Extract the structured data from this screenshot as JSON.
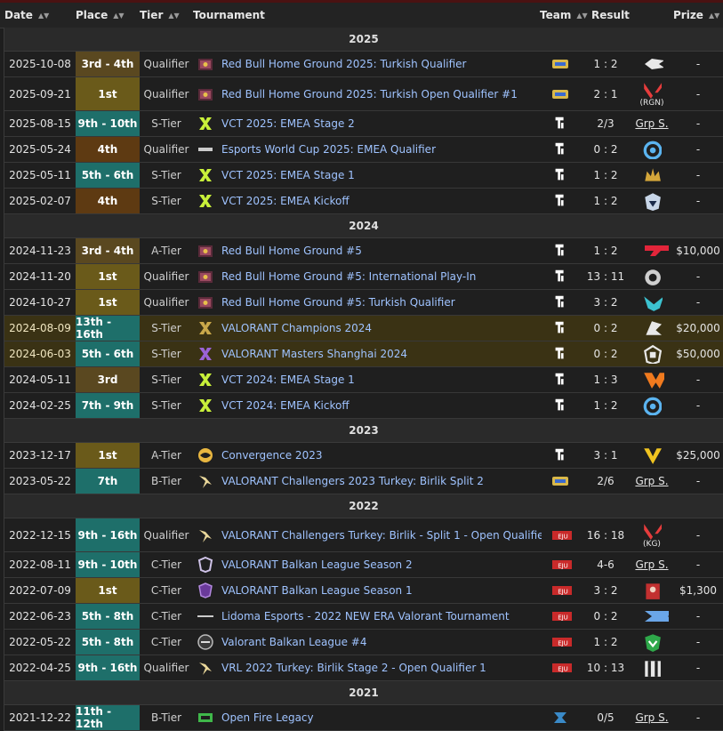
{
  "header": {
    "date": "Date",
    "place": "Place",
    "tier": "Tier",
    "tournament": "Tournament",
    "team": "Team",
    "result": "Result",
    "prize": "Prize"
  },
  "sections": [
    {
      "year": "2025",
      "rows": [
        {
          "date": "2025-10-08",
          "place": "3rd - 4th",
          "placeClass": "third",
          "tier": "Qualifier",
          "tierIcon": "redbull-icon",
          "tournament": "Red Bull Home Ground 2025: Turkish Qualifier",
          "team": "team-logo-yellow-icon",
          "score": "1 : 2",
          "opponent": "horse-head-icon",
          "prize": "-",
          "h": 29
        },
        {
          "date": "2025-09-21",
          "place": "1st",
          "placeClass": "gold",
          "tier": "Qualifier",
          "tierIcon": "redbull-icon",
          "tournament": "Red Bull Home Ground 2025: Turkish Open Qualifier #1",
          "team": "team-logo-yellow-icon",
          "score": "2 : 1",
          "opponent": "valorant-red-icon",
          "opponentLabel": "(RGN)",
          "prize": "-",
          "h": 38
        },
        {
          "date": "2025-08-15",
          "place": "9th - 10th",
          "placeClass": "teal",
          "tier": "S-Tier",
          "tierIcon": "vct-icon",
          "tournament": "VCT 2025: EMEA Stage 2",
          "team": "team-logo-white-icon",
          "score": "2/3",
          "opponent": "",
          "opponentText": "Grp S.",
          "prize": "-",
          "h": 29
        },
        {
          "date": "2025-05-24",
          "place": "4th",
          "placeClass": "fourth",
          "tier": "Qualifier",
          "tierIcon": "ewc-icon",
          "tournament": "Esports World Cup 2025: EMEA Qualifier",
          "team": "team-logo-white-icon",
          "score": "0 : 2",
          "opponent": "blue-swirl-icon",
          "prize": "-",
          "h": 29
        },
        {
          "date": "2025-05-11",
          "place": "5th - 6th",
          "placeClass": "teal",
          "tier": "S-Tier",
          "tierIcon": "vct-icon",
          "tournament": "VCT 2025: EMEA Stage 1",
          "team": "team-logo-white-icon",
          "score": "1 : 2",
          "opponent": "gold-crown-icon",
          "prize": "-",
          "h": 29
        },
        {
          "date": "2025-02-07",
          "place": "4th",
          "placeClass": "fourth",
          "tier": "S-Tier",
          "tierIcon": "vct-icon",
          "tournament": "VCT 2025: EMEA Kickoff",
          "team": "team-logo-white-icon",
          "score": "1 : 2",
          "opponent": "liquid-icon",
          "prize": "-",
          "h": 29
        }
      ]
    },
    {
      "year": "2024",
      "rows": [
        {
          "date": "2024-11-23",
          "place": "3rd - 4th",
          "placeClass": "third",
          "tier": "A-Tier",
          "tierIcon": "redbull-icon",
          "tournament": "Red Bull Home Ground #5",
          "team": "team-logo-white-icon",
          "score": "1 : 2",
          "opponent": "t1-icon",
          "prize": "$10,000",
          "h": 29
        },
        {
          "date": "2024-11-20",
          "place": "1st",
          "placeClass": "gold",
          "tier": "Qualifier",
          "tierIcon": "redbull-icon",
          "tournament": "Red Bull Home Ground #5: International Play-In",
          "team": "team-logo-white-icon",
          "score": "13 : 11",
          "opponent": "g2-icon",
          "prize": "-",
          "h": 29
        },
        {
          "date": "2024-10-27",
          "place": "1st",
          "placeClass": "gold",
          "tier": "Qualifier",
          "tierIcon": "redbull-icon",
          "tournament": "Red Bull Home Ground #5: Turkish Qualifier",
          "team": "team-logo-white-icon",
          "score": "3 : 2",
          "opponent": "teal-wings-icon",
          "prize": "-",
          "h": 29
        },
        {
          "date": "2024-08-09",
          "place": "13th - 16th",
          "placeClass": "teal",
          "tier": "S-Tier",
          "tierIcon": "champions-icon",
          "tournament": "VALORANT Champions 2024",
          "team": "team-logo-white-icon",
          "score": "0 : 2",
          "opponent": "prx-icon",
          "prize": "$20,000",
          "h": 29,
          "hl": true
        },
        {
          "date": "2024-06-03",
          "place": "5th - 6th",
          "placeClass": "teal",
          "tier": "S-Tier",
          "tierIcon": "masters-icon",
          "tournament": "VALORANT Masters Shanghai 2024",
          "team": "team-logo-white-icon",
          "score": "0 : 2",
          "opponent": "fnatic-white-icon",
          "prize": "$50,000",
          "h": 29,
          "hl": true
        },
        {
          "date": "2024-05-11",
          "place": "3rd",
          "placeClass": "third",
          "tier": "S-Tier",
          "tierIcon": "vct-icon",
          "tournament": "VCT 2024: EMEA Stage 1",
          "team": "team-logo-white-icon",
          "score": "1 : 3",
          "opponent": "fnatic-orange-icon",
          "prize": "-",
          "h": 29
        },
        {
          "date": "2024-02-25",
          "place": "7th - 9th",
          "placeClass": "teal",
          "tier": "S-Tier",
          "tierIcon": "vct-icon",
          "tournament": "VCT 2024: EMEA Kickoff",
          "team": "team-logo-white-icon",
          "score": "1 : 2",
          "opponent": "blue-swirl-icon",
          "prize": "-",
          "h": 29
        }
      ]
    },
    {
      "year": "2023",
      "rows": [
        {
          "date": "2023-12-17",
          "place": "1st",
          "placeClass": "gold",
          "tier": "A-Tier",
          "tierIcon": "convergence-icon",
          "tournament": "Convergence 2023",
          "team": "team-logo-white-icon",
          "score": "3 : 1",
          "opponent": "vitality-icon",
          "prize": "$25,000",
          "h": 29
        },
        {
          "date": "2023-05-22",
          "place": "7th",
          "placeClass": "teal",
          "tier": "B-Tier",
          "tierIcon": "challengers-icon",
          "tournament": "VALORANT Challengers 2023 Turkey: Birlik Split 2",
          "team": "team-logo-yellow-icon",
          "score": "2/6",
          "opponent": "",
          "opponentText": "Grp S.",
          "prize": "-",
          "h": 29
        }
      ]
    },
    {
      "year": "2022",
      "rows": [
        {
          "date": "2022-12-15",
          "place": "9th - 16th",
          "placeClass": "teal",
          "tier": "Qualifier",
          "tierIcon": "challengers-icon",
          "tournament": "VALORANT Challengers Turkey: Birlik - Split 1 - Open Qualifier 2",
          "team": "team-logo-red-icon",
          "score": "16 : 18",
          "opponent": "valorant-red-icon",
          "opponentLabel": "(KG)",
          "prize": "-",
          "h": 38
        },
        {
          "date": "2022-08-11",
          "place": "9th - 10th",
          "placeClass": "teal",
          "tier": "C-Tier",
          "tierIcon": "balkan-icon",
          "tournament": "VALORANT Balkan League Season 2",
          "team": "team-logo-red-icon",
          "score": "4-6",
          "opponent": "",
          "opponentText": "Grp S.",
          "prize": "-",
          "h": 29
        },
        {
          "date": "2022-07-09",
          "place": "1st",
          "placeClass": "gold",
          "tier": "C-Tier",
          "tierIcon": "balkan-purple-icon",
          "tournament": "VALORANT Balkan League Season 1",
          "team": "team-logo-red-icon",
          "score": "3 : 2",
          "opponent": "red-char-icon",
          "prize": "$1,300",
          "h": 29
        },
        {
          "date": "2022-06-23",
          "place": "5th - 8th",
          "placeClass": "teal",
          "tier": "C-Tier",
          "tierIcon": "lidoma-icon",
          "tournament": "Lidoma Esports - 2022 NEW ERA Valorant Tournament",
          "team": "team-logo-red-icon",
          "score": "0 : 2",
          "opponent": "fx-icon",
          "prize": "-",
          "h": 29
        },
        {
          "date": "2022-05-22",
          "place": "5th - 8th",
          "placeClass": "teal",
          "tier": "C-Tier",
          "tierIcon": "balkan-grey-icon",
          "tournament": "Valorant Balkan League #4",
          "team": "team-logo-red-icon",
          "score": "1 : 2",
          "opponent": "green-shield-icon",
          "prize": "-",
          "h": 29
        },
        {
          "date": "2022-04-25",
          "place": "9th - 16th",
          "placeClass": "teal",
          "tier": "Qualifier",
          "tierIcon": "challengers-icon",
          "tournament": "VRL 2022 Turkey: Birlik Stage 2 - Open Qualifier 1",
          "team": "team-logo-red-icon",
          "score": "10 : 13",
          "opponent": "stripes-icon",
          "prize": "-",
          "h": 29
        }
      ]
    },
    {
      "year": "2021",
      "rows": [
        {
          "date": "2021-12-22",
          "place": "11th - 12th",
          "placeClass": "teal",
          "tier": "B-Tier",
          "tierIcon": "openfire-icon",
          "tournament": "Open Fire Legacy",
          "team": "team-logo-blue-icon",
          "score": "0/5",
          "opponent": "",
          "opponentText": "Grp S.",
          "prize": "-",
          "h": 29
        }
      ]
    }
  ]
}
